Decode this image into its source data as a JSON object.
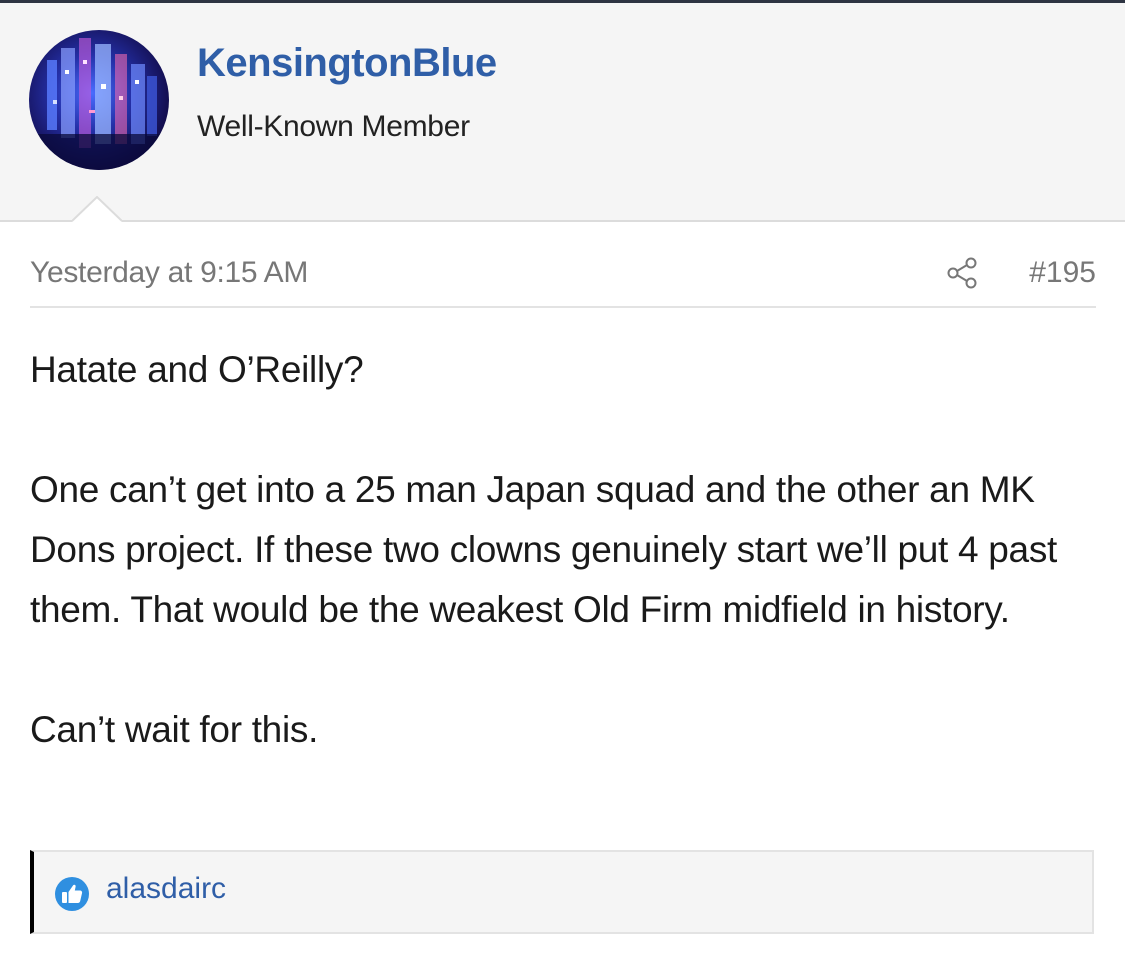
{
  "user": {
    "username": "KensingtonBlue",
    "title": "Well-Known Member",
    "avatar_icon": "avatar-city-lights"
  },
  "post": {
    "date": "Yesterday at 9:15 AM",
    "number": "#195",
    "share_icon": "share-icon",
    "paragraphs": [
      "Hatate and O’Reilly?",
      "One can’t get into a 25 man Japan squad and the other an MK Dons project. If these two clowns genuinely start we’ll put 4 past them. That would be the weakest Old Firm midfield in history.",
      "Can’t wait for this."
    ]
  },
  "likes": {
    "icon": "thumbs-up-icon",
    "users": "alasdairc"
  },
  "colors": {
    "link": "#2f5ea7",
    "like_badge": "#2f8fe0",
    "meta_text": "#777777"
  }
}
